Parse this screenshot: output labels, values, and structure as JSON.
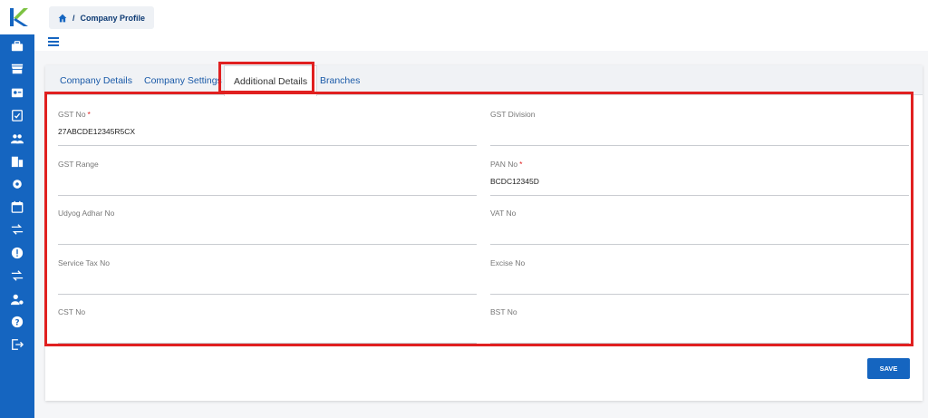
{
  "breadcrumb": {
    "current": "Company Profile",
    "separator": "/"
  },
  "tabs": [
    {
      "label": "Company Details"
    },
    {
      "label": "Company Settings"
    },
    {
      "label": "Additional Details"
    },
    {
      "label": "Branches"
    }
  ],
  "active_tab": "Additional Details",
  "fields": [
    {
      "label": "GST No",
      "required": "*",
      "value": "27ABCDE12345R5CX"
    },
    {
      "label": "GST Division",
      "required": "",
      "value": ""
    },
    {
      "label": "GST Range",
      "required": "",
      "value": ""
    },
    {
      "label": "PAN No",
      "required": "*",
      "value": "BCDC12345D"
    },
    {
      "label": "Udyog Adhar No",
      "required": "",
      "value": ""
    },
    {
      "label": "VAT No",
      "required": "",
      "value": ""
    },
    {
      "label": "Service Tax No",
      "required": "",
      "value": ""
    },
    {
      "label": "Excise No",
      "required": "",
      "value": ""
    },
    {
      "label": "CST No",
      "required": "",
      "value": ""
    },
    {
      "label": "BST No",
      "required": "",
      "value": ""
    }
  ],
  "save_label": "SAVE",
  "colors": {
    "primary": "#1565c0",
    "highlight": "#e02020",
    "logo_green": "#7cc242"
  },
  "sidebar_icons": [
    "briefcase-icon",
    "store-icon",
    "contact-card-icon",
    "clipboard-check-icon",
    "group-icon",
    "building-icon",
    "gear-icon",
    "calendar-icon",
    "swap-icon",
    "alert-icon",
    "swap-icon-2",
    "user-settings-icon",
    "help-icon",
    "logout-icon"
  ]
}
